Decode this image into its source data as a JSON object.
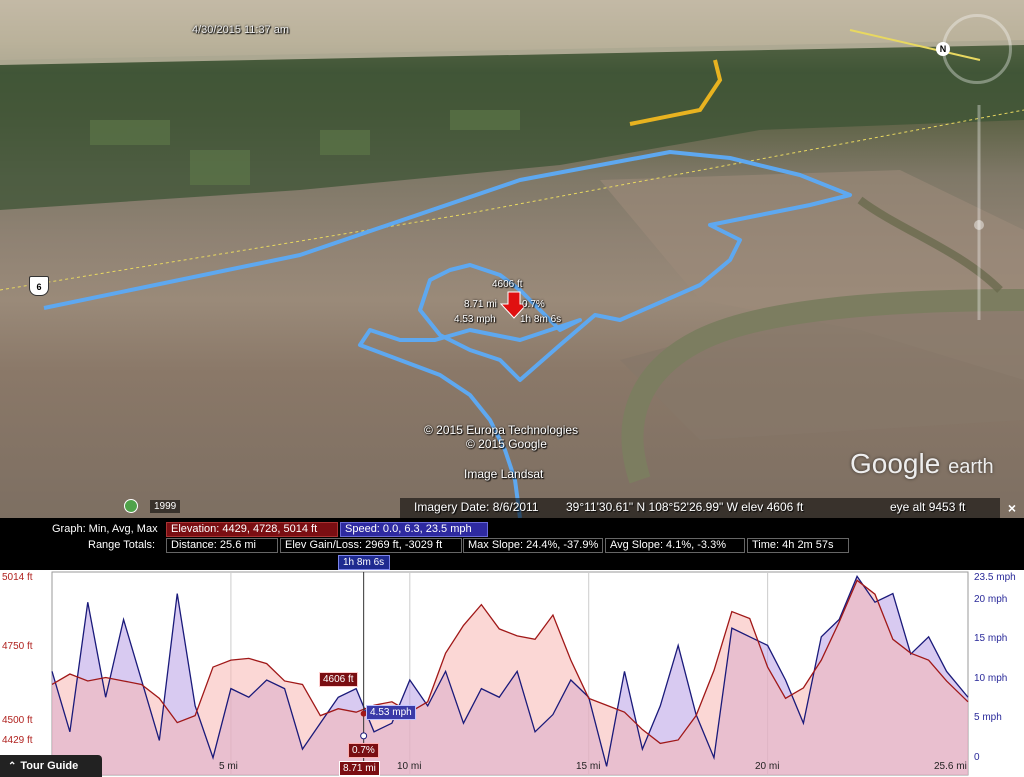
{
  "map": {
    "timestamp": "4/30/2015  11:37 am",
    "route_shield": "6",
    "cursor_tooltip": {
      "elevation": "4606 ft",
      "distance": "8.71 mi",
      "slope": "0.7%",
      "speed": "4.53 mph",
      "time": "1h 8m 6s"
    },
    "copyright": [
      "© 2015 Europa Technologies",
      "© 2015 Google",
      "Image Landsat"
    ],
    "brand_main": "Google",
    "brand_sub": "earth",
    "history_year": "1999",
    "status": {
      "imagery_date": "Imagery Date: 8/6/2011",
      "coordinates": "39°11'30.61\" N  108°52'26.99\" W  elev  4606 ft",
      "eye_alt": "eye alt   9453 ft"
    },
    "north_button": "N",
    "colors": {
      "track": "#5ea8f0",
      "road": "#e8b320",
      "marker": "#e01010"
    }
  },
  "panel": {
    "graph_label": "Graph: Min, Avg, Max",
    "range_label": "Range Totals:",
    "elevation_chip": "Elevation: 4429, 4728, 5014 ft",
    "speed_chip": "Speed: 0.0, 6.3, 23.5 mph",
    "distance_chip": "Distance: 25.6 mi",
    "gain_chip": "Elev Gain/Loss: 2969 ft, -3029 ft",
    "maxslope_chip": "Max Slope: 24.4%, -37.9%",
    "avgslope_chip": "Avg Slope: 4.1%, -3.3%",
    "time_chip": "Time: 4h 2m 57s",
    "time_marker": "1h 8m 6s",
    "close_label": "×",
    "tour_guide": "Tour Guide",
    "marker": {
      "elevation": "4606 ft",
      "speed": "4.53 mph",
      "slope": "0.7%",
      "distance": "8.71 mi"
    }
  },
  "chart_data": {
    "type": "area",
    "x_unit": "mi",
    "xlim": [
      0,
      25.6
    ],
    "x_ticks": [
      "5 mi",
      "10 mi",
      "15 mi",
      "20 mi",
      "25.6 mi"
    ],
    "y_left_ticks": [
      "5014 ft",
      "4750 ft",
      "4500 ft",
      "4429 ft"
    ],
    "y_left_lim": [
      4429,
      5014
    ],
    "y_right_ticks": [
      "23.5 mph",
      "20 mph",
      "15 mph",
      "10 mph",
      "5 mph",
      "0"
    ],
    "y_right_lim": [
      0,
      23.5
    ],
    "series": [
      {
        "name": "Elevation",
        "axis": "left",
        "color": "#a01818",
        "x": [
          0,
          0.5,
          1,
          1.5,
          2,
          2.5,
          3,
          3.5,
          4,
          4.5,
          5,
          5.5,
          6,
          6.5,
          7,
          7.5,
          8,
          8.5,
          9,
          9.5,
          10,
          10.5,
          11,
          11.5,
          12,
          12.5,
          13,
          13.5,
          14,
          14.5,
          15,
          15.5,
          16,
          16.5,
          17,
          17.5,
          18,
          18.5,
          19,
          19.5,
          20,
          20.5,
          21,
          21.5,
          22,
          22.5,
          23,
          23.5,
          24,
          24.5,
          25,
          25.6
        ],
        "values": [
          4690,
          4720,
          4700,
          4710,
          4700,
          4690,
          4650,
          4580,
          4600,
          4740,
          4760,
          4765,
          4750,
          4700,
          4690,
          4600,
          4620,
          4610,
          4630,
          4640,
          4610,
          4640,
          4780,
          4860,
          4920,
          4850,
          4830,
          4820,
          4890,
          4760,
          4650,
          4630,
          4610,
          4560,
          4520,
          4530,
          4600,
          4730,
          4900,
          4880,
          4740,
          4650,
          4680,
          4760,
          4870,
          4990,
          4950,
          4820,
          4780,
          4760,
          4700,
          4640
        ]
      },
      {
        "name": "Speed",
        "axis": "right",
        "color": "#1a1a7a",
        "x": [
          0,
          0.5,
          1,
          1.5,
          2,
          2.5,
          3,
          3.5,
          4,
          4.5,
          5,
          5.5,
          6,
          6.5,
          7,
          7.5,
          8,
          8.5,
          9,
          9.5,
          10,
          10.5,
          11,
          11.5,
          12,
          12.5,
          13,
          13.5,
          14,
          14.5,
          15,
          15.5,
          16,
          16.5,
          17,
          17.5,
          18,
          18.5,
          19,
          19.5,
          20,
          20.5,
          21,
          21.5,
          22,
          22.5,
          23,
          23.5,
          24,
          24.5,
          25,
          25.6
        ],
        "values": [
          12,
          5,
          20,
          9,
          18,
          11,
          4,
          21,
          8,
          2,
          10,
          9,
          11,
          10,
          3,
          6,
          9,
          10,
          5,
          6,
          11,
          8,
          12,
          6,
          10,
          9,
          12,
          5,
          7,
          11,
          9,
          1,
          12,
          3,
          8,
          15,
          7,
          2,
          17,
          16,
          15,
          11,
          6,
          16,
          18,
          23,
          20,
          21,
          14,
          16,
          12,
          9
        ]
      }
    ],
    "cursor": {
      "x": 8.71,
      "elevation": 4606,
      "speed": 4.53
    }
  }
}
